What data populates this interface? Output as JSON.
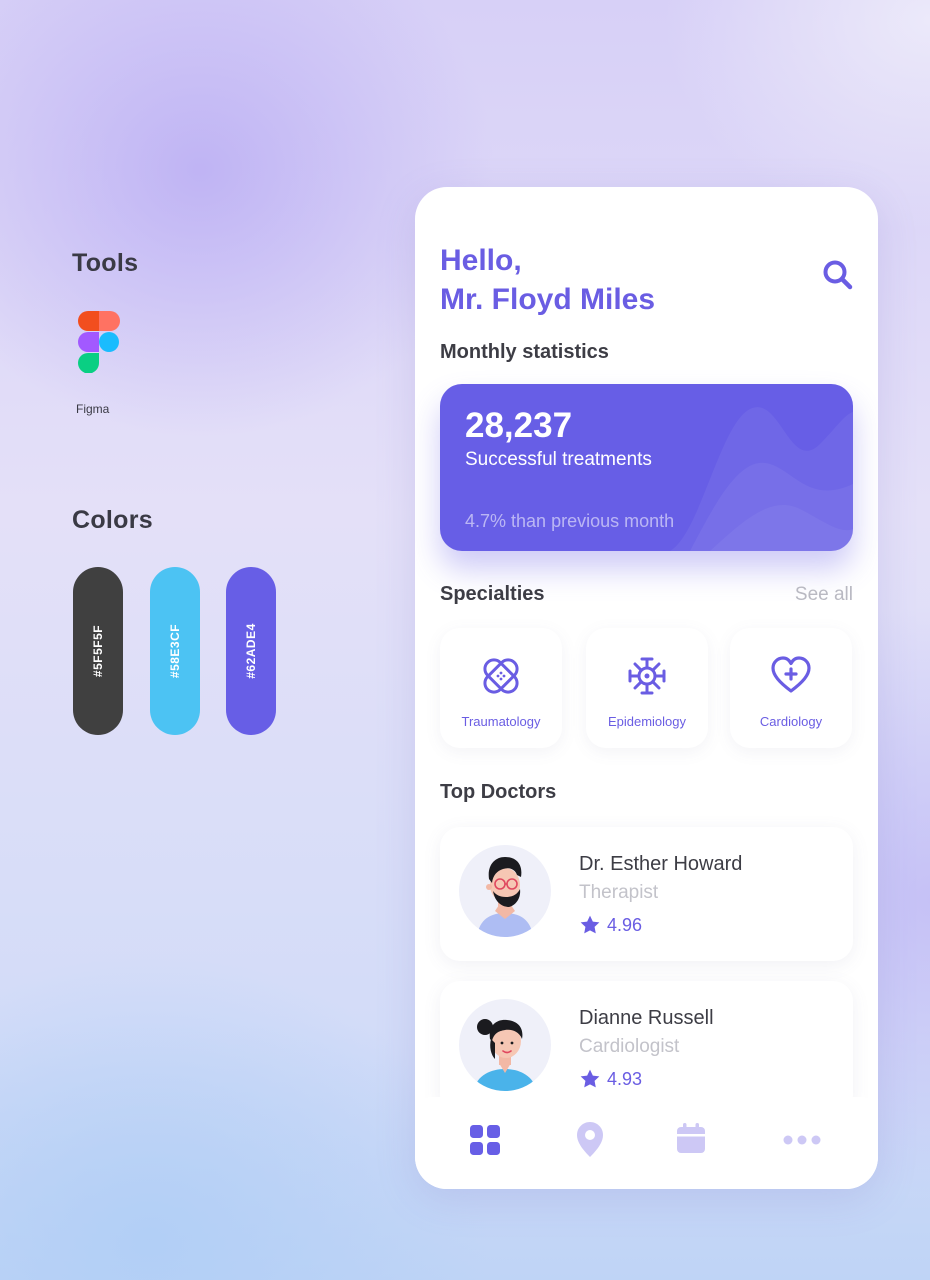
{
  "tools": {
    "title": "Tools",
    "items": [
      {
        "name": "Figma",
        "icon": "figma-logo"
      }
    ]
  },
  "colors": {
    "title": "Colors",
    "swatches": [
      {
        "label": "#5F5F5F",
        "hex": "#404040"
      },
      {
        "label": "#58E3CF",
        "hex": "#4cc3f3"
      },
      {
        "label": "#62ADE4",
        "hex": "#675ee6"
      }
    ]
  },
  "app": {
    "greeting_line1": "Hello,",
    "greeting_line2": "Mr. Floyd Miles",
    "search_icon": "search-icon",
    "accent": "#675ee6",
    "monthly": {
      "heading": "Monthly statistics",
      "value": "28,237",
      "label": "Successful treatments",
      "comparison": "4.7% than previous month"
    },
    "specialties": {
      "heading": "Specialties",
      "see_all": "See all",
      "items": [
        {
          "label": "Traumatology",
          "icon": "bandage-icon"
        },
        {
          "label": "Epidemiology",
          "icon": "virus-icon"
        },
        {
          "label": "Cardiology",
          "icon": "heart-plus-icon"
        }
      ]
    },
    "doctors": {
      "heading": "Top Doctors",
      "items": [
        {
          "name": "Dr. Esther Howard",
          "role": "Therapist",
          "rating": "4.96"
        },
        {
          "name": "Dianne Russell",
          "role": "Cardiologist",
          "rating": "4.93"
        }
      ]
    },
    "nav": [
      {
        "icon": "grid-icon",
        "active": true
      },
      {
        "icon": "location-pin-icon",
        "active": false
      },
      {
        "icon": "calendar-icon",
        "active": false
      },
      {
        "icon": "more-dots-icon",
        "active": false
      }
    ]
  }
}
